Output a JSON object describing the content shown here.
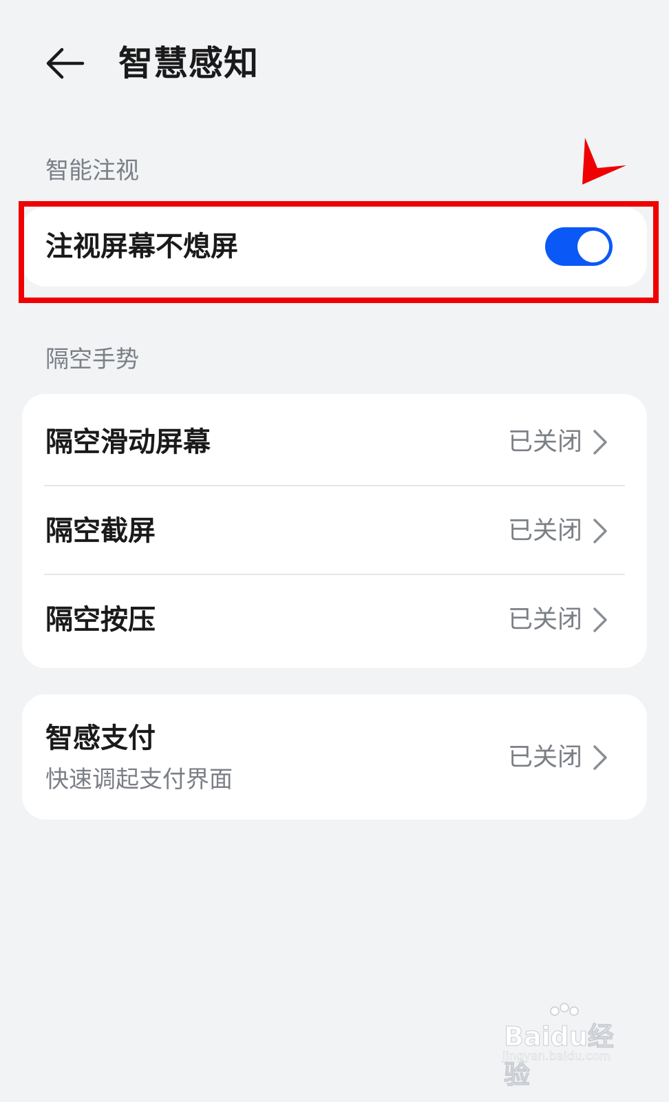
{
  "header": {
    "title": "智慧感知",
    "back_icon": "back-arrow-icon"
  },
  "sections": {
    "gaze": {
      "header": "智能注视",
      "items": [
        {
          "label": "注视屏幕不熄屏",
          "toggle_on": true
        }
      ]
    },
    "air_gestures": {
      "header": "隔空手势",
      "items": [
        {
          "label": "隔空滑动屏幕",
          "status": "已关闭"
        },
        {
          "label": "隔空截屏",
          "status": "已关闭"
        },
        {
          "label": "隔空按压",
          "status": "已关闭"
        }
      ]
    },
    "payment": {
      "items": [
        {
          "label": "智感支付",
          "sublabel": "快速调起支付界面",
          "status": "已关闭"
        }
      ]
    }
  },
  "colors": {
    "accent": "#0a59f7",
    "annotation": "#f00000",
    "background": "#f1f3f5"
  },
  "watermark": {
    "brand": "Baidu经验",
    "url": "jingyan.baidu.com"
  }
}
